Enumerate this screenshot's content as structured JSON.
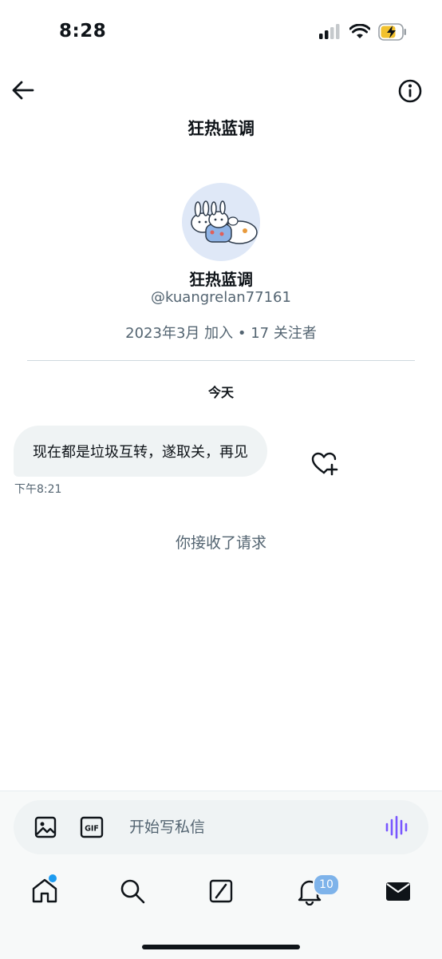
{
  "status_bar": {
    "time": "8:28",
    "icons": [
      "signal-icon",
      "wifi-icon",
      "battery-charging-icon"
    ]
  },
  "header": {
    "title": "狂热蓝调",
    "back_icon": "arrow-left-icon",
    "info_icon": "info-icon"
  },
  "profile": {
    "name": "狂热蓝调",
    "handle": "@kuangrelan77161",
    "meta": "2023年3月 加入 • 17 关注者"
  },
  "conversation": {
    "date_separator": "今天",
    "messages": [
      {
        "text": "现在都是垃圾互转，遂取关，再见",
        "time": "下午8:21"
      }
    ],
    "system_note": "你接收了请求"
  },
  "composer": {
    "placeholder": "开始写私信",
    "gif_label": "GIF",
    "icons": [
      "image-icon",
      "gif-icon",
      "voice-icon"
    ]
  },
  "bottom_nav": {
    "items": [
      "home-icon",
      "search-icon",
      "grok-icon",
      "bell-icon",
      "mail-icon"
    ],
    "notification_count": "10"
  },
  "colors": {
    "accent": "#1d9bf0",
    "secondary_text": "#536471",
    "bubble_bg": "#eff3f4",
    "voice_accent": "#7856ff"
  }
}
